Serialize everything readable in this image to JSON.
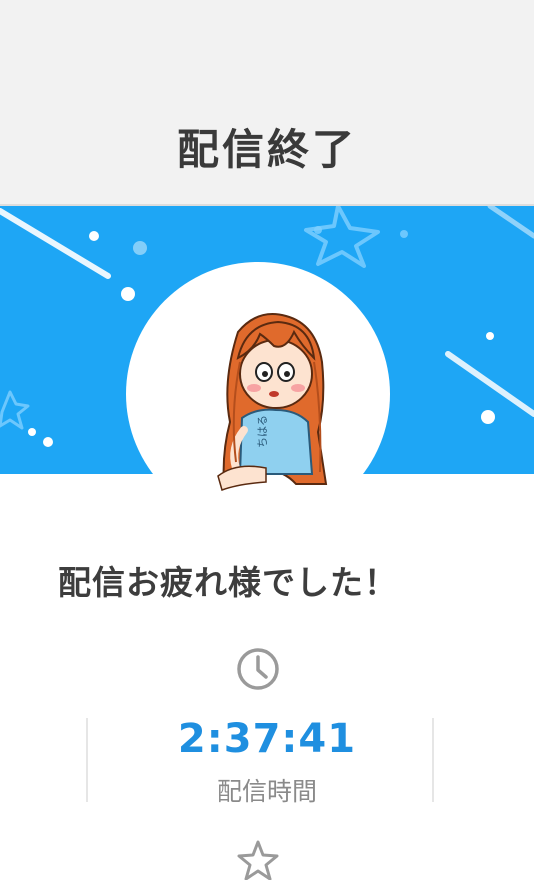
{
  "header": {
    "title": "配信終了"
  },
  "avatar": {
    "caption": "ちはる",
    "icon": "character-illustration"
  },
  "message": "配信お疲れ様でした！",
  "stats": [
    {
      "icon": "clock-icon",
      "value": "2:37:41",
      "label": "配信時間"
    },
    {
      "icon": "star-icon"
    }
  ],
  "colors": {
    "header_bg": "#f2f2f2",
    "banner_bg": "#1ea6f5",
    "accent": "#1f8fe0",
    "text": "#3d3d3d",
    "muted": "#8a8a8a"
  }
}
